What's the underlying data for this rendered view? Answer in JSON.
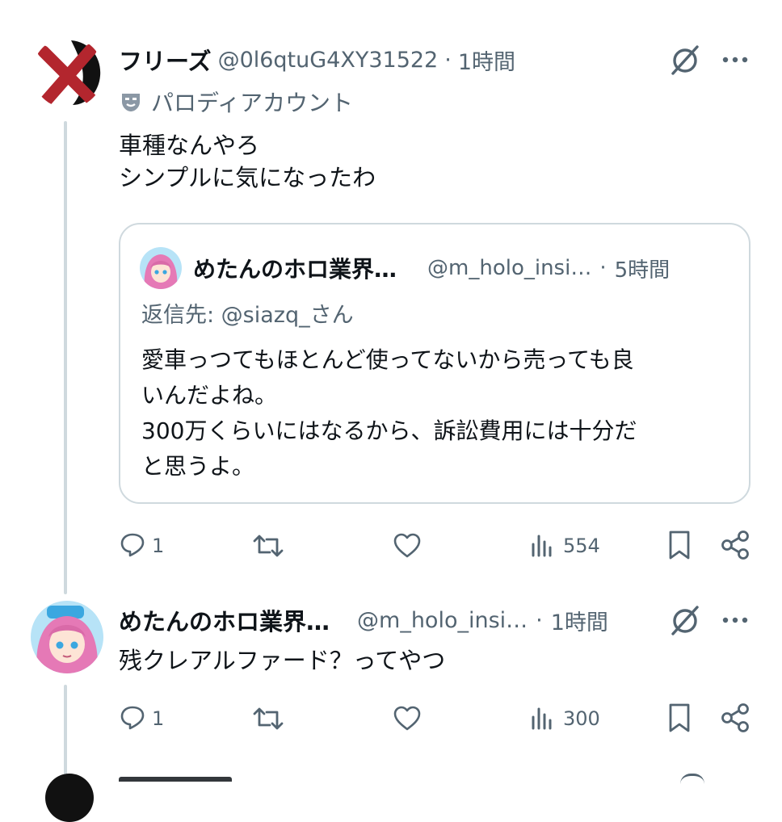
{
  "post1": {
    "display_name": "フリーズ",
    "handle": "@0l6qtuG4XY31522",
    "sep": "·",
    "time": "1時間",
    "parody_label": "パロディアカウント",
    "text": "車種なんやろ\nシンプルに気になったわ",
    "quote": {
      "display_name": "めたんのホロ業界…",
      "handle": "@m_holo_insi…",
      "sep": "·",
      "time": "5時間",
      "reply_to": "返信先: @siazq_さん",
      "text": "愛車っつてもほとんど使ってないから売っても良\nいんだよね。\n300万くらいにはなるから、訴訟費用には十分だ\nと思うよ。"
    },
    "actions": {
      "replies": "1",
      "views": "554"
    }
  },
  "post2": {
    "display_name": "めたんのホロ業界…",
    "handle": "@m_holo_insi…",
    "sep": "·",
    "time": "1時間",
    "text": "残クレアルファード？ってやつ",
    "actions": {
      "replies": "1",
      "views": "300"
    }
  },
  "colors": {
    "text": "#0f1419",
    "secondary": "#536471",
    "border": "#cfd9de",
    "avatar_red": "#b3262e",
    "avatar_blue": "#3ba7e0",
    "hair_pink": "#e579b6"
  },
  "icons": [
    "grok-icon",
    "more-icon",
    "parody-mask-icon",
    "reply-icon",
    "retweet-icon",
    "like-icon",
    "views-icon",
    "bookmark-icon",
    "share-icon"
  ]
}
